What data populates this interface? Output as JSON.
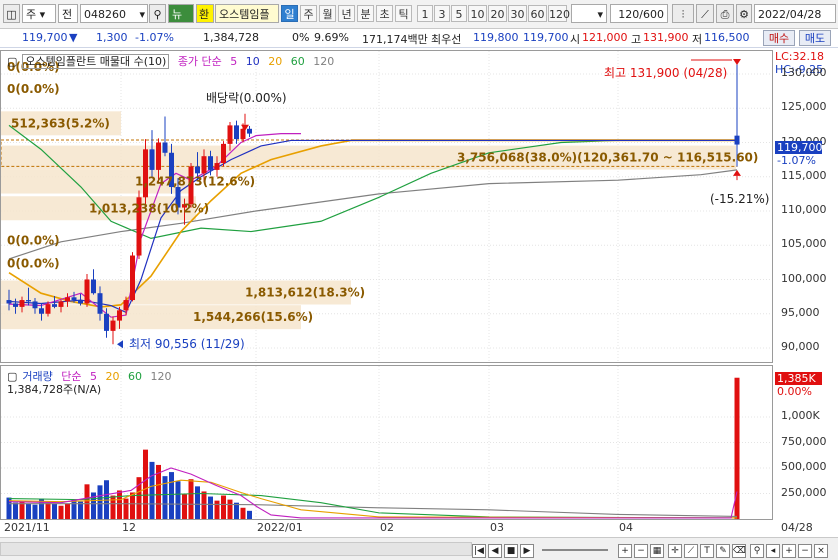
{
  "toolbar": {
    "market_type": "주",
    "scope": "전",
    "stock_code": "048260",
    "news_label": "뉴",
    "exchange_label": "환",
    "stock_name": "오스템임플",
    "periods": [
      "일",
      "주",
      "월",
      "년",
      "분",
      "초",
      "틱"
    ],
    "active_period": "일",
    "intervals": [
      "1",
      "3",
      "5",
      "10",
      "20",
      "30",
      "60",
      "120"
    ],
    "count_display": "120/600",
    "date": "2022/04/28"
  },
  "quote": {
    "price": "119,700",
    "change": "1,300",
    "change_pct": "-1.07%",
    "volume": "1,384,728",
    "zero_pct": "0%",
    "turnover_pct": "9.69%",
    "trade_value": "171,174백만",
    "best_sell_label": "최우선",
    "best_ask": "119,800",
    "best_bid": "119,700",
    "open_label": "시",
    "open": "121,000",
    "high_label": "고",
    "high": "131,900",
    "low_label": "저",
    "low": "116,500",
    "buy_button": "매수",
    "sell_button": "매도"
  },
  "price_pane": {
    "legend_title": "오스템임플란트 매물대 수(10)",
    "legend_ma_label": "종가 단순",
    "legend_ma_periods": [
      "5",
      "10",
      "20",
      "60",
      "120"
    ],
    "max_annotation": "최고 131,900 (04/28)",
    "min_annotation": "최저 90,556 (11/29)",
    "dividend_label": "배당락(0.00%)",
    "change_annotation": "(-15.21%)",
    "lc_label": "LC:32.18",
    "hc_label": "HC:-9.25",
    "current_price_tag": "119,700",
    "current_pct_tag": "-1.07%",
    "volume_profile": [
      {
        "label": "0(0.0%)",
        "price": 131000
      },
      {
        "label": "0(0.0%)",
        "price": 127800
      },
      {
        "label": "512,363(5.2%)",
        "price": 122800
      },
      {
        "label": "3,756,068(38.0%)(120,361.70 ~ 116,515.60)",
        "price": 117800
      },
      {
        "label": "1,247,873(12.6%)",
        "price": 114300
      },
      {
        "label": "1,013,238(10.2%)",
        "price": 110400
      },
      {
        "label": "0(0.0%)",
        "price": 105700
      },
      {
        "label": "0(0.0%)",
        "price": 102300
      },
      {
        "label": "1,813,612(18.3%)",
        "price": 98100
      },
      {
        "label": "1,544,266(15.6%)",
        "price": 94500
      }
    ],
    "y_ticks": [
      "130,000",
      "125,000",
      "120,000",
      "115,000",
      "110,000",
      "105,000",
      "100,000",
      "95,000",
      "90,000"
    ]
  },
  "volume_pane": {
    "legend_title": "거래량",
    "legend_ma_label": "단순",
    "legend_ma_periods": [
      "5",
      "20",
      "60",
      "120"
    ],
    "volume_readout": "1,384,728주(N/A)",
    "current_volume_tag": "1,385K",
    "current_pct_tag": "0.00%",
    "y_ticks": [
      "1,000K",
      "750,000",
      "500,000",
      "250,000"
    ]
  },
  "x_axis": {
    "labels": [
      "2021/11",
      "12",
      "2022/01",
      "02",
      "03",
      "04",
      "04/28"
    ]
  },
  "colors": {
    "up": "#e01010",
    "down": "#1a40c0",
    "ma5": "#c020c0",
    "ma10": "#2030c0",
    "ma20": "#e8a000",
    "ma60": "#20a040",
    "ma120": "#808080",
    "profile_fill": "#f6e5cc",
    "profile_text": "#8a5a00"
  },
  "chart_data": {
    "type": "candlestick",
    "y_range": [
      87000,
      133000
    ],
    "max": {
      "date": "04/28",
      "price": 131900
    },
    "min": {
      "date": "11/29",
      "price": 90556
    },
    "last": {
      "open": 121000,
      "high": 131900,
      "low": 116500,
      "close": 119700,
      "volume": 1384728
    },
    "candles": [
      [
        97000,
        98500,
        95500,
        96500
      ],
      [
        96500,
        97200,
        95000,
        96000
      ],
      [
        96000,
        97500,
        95200,
        97000
      ],
      [
        97000,
        98800,
        96200,
        96800
      ],
      [
        96800,
        97300,
        95000,
        95800
      ],
      [
        95800,
        96500,
        94000,
        95000
      ],
      [
        95000,
        96800,
        94600,
        96400
      ],
      [
        96400,
        97600,
        95800,
        96000
      ],
      [
        96000,
        97000,
        95200,
        96800
      ],
      [
        96800,
        98000,
        96000,
        97400
      ],
      [
        97400,
        98200,
        96600,
        97000
      ],
      [
        97000,
        97900,
        96200,
        96500
      ],
      [
        96500,
        100800,
        96000,
        100000
      ],
      [
        100000,
        101500,
        97800,
        98000
      ],
      [
        98000,
        99000,
        94000,
        95000
      ],
      [
        95000,
        95800,
        91500,
        92500
      ],
      [
        92500,
        94600,
        90556,
        94000
      ],
      [
        94000,
        96000,
        92800,
        95500
      ],
      [
        95500,
        97500,
        94800,
        97000
      ],
      [
        97000,
        104000,
        96800,
        103500
      ],
      [
        103500,
        113000,
        103000,
        112000
      ],
      [
        112000,
        120500,
        111000,
        119000
      ],
      [
        119000,
        121800,
        115000,
        116000
      ],
      [
        116000,
        120600,
        114000,
        120000
      ],
      [
        120000,
        123800,
        118000,
        118500
      ],
      [
        118500,
        119800,
        112500,
        113500
      ],
      [
        113500,
        114800,
        109500,
        110500
      ],
      [
        110500,
        111800,
        108000,
        111000
      ],
      [
        111000,
        117000,
        110500,
        116500
      ],
      [
        116500,
        118600,
        114500,
        115500
      ],
      [
        115500,
        119000,
        114200,
        118000
      ],
      [
        118000,
        118800,
        115200,
        116000
      ],
      [
        116000,
        118000,
        115000,
        117000
      ],
      [
        117000,
        120200,
        116500,
        119800
      ],
      [
        119800,
        123000,
        118800,
        122500
      ],
      [
        122500,
        123200,
        119800,
        120500
      ],
      [
        120500,
        122800,
        120000,
        122000
      ],
      [
        122000,
        122400,
        120800,
        121300
      ]
    ],
    "last_candle": [
      121000,
      131900,
      116500,
      119700
    ],
    "volumes_k": [
      210,
      160,
      180,
      150,
      140,
      200,
      170,
      150,
      130,
      150,
      190,
      170,
      340,
      260,
      330,
      380,
      230,
      280,
      200,
      260,
      410,
      680,
      560,
      530,
      420,
      460,
      370,
      240,
      390,
      320,
      270,
      220,
      180,
      230,
      190,
      160,
      110,
      80
    ],
    "last_volume_k": 1385
  }
}
